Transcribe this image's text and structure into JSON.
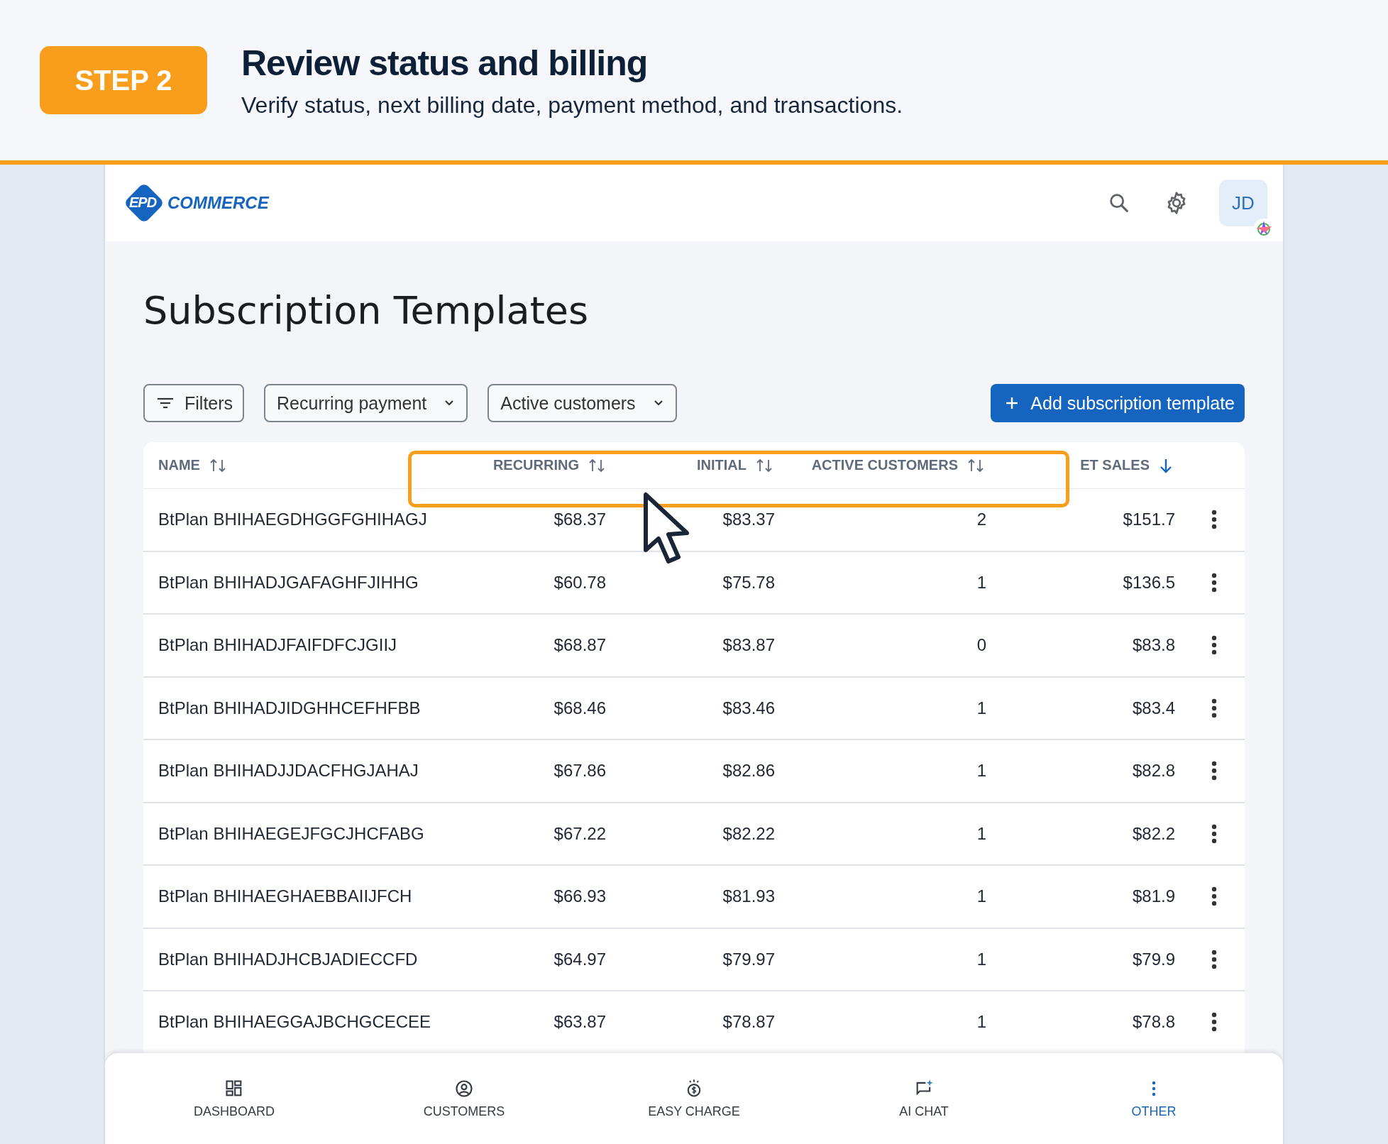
{
  "banner": {
    "step": "STEP 2",
    "title": "Review status and billing",
    "subtitle": "Verify status, next billing date, payment method, and transactions."
  },
  "header": {
    "logo_mark": "EPD",
    "logo_text": "COMMERCE",
    "avatar": "JD"
  },
  "page_title": "Subscription Templates",
  "toolbar": {
    "filters": "Filters",
    "dropdowns": [
      "Recurring payment",
      "Active customers"
    ],
    "add_button": "Add subscription template"
  },
  "table": {
    "columns": [
      {
        "label": "NAME",
        "kind": "sortable"
      },
      {
        "label": "RECURRING",
        "kind": "sortable"
      },
      {
        "label": "INITIAL",
        "kind": "sortable"
      },
      {
        "label": "ACTIVE CUSTOMERS",
        "kind": "sortable"
      },
      {
        "label": "ET SALES",
        "kind": "sorted"
      }
    ],
    "rows": [
      {
        "name": "BtPlan BHIHAEGDHGGFGHIHAGJ",
        "recurring": "$68.37",
        "initial": "$83.37",
        "active_customers": "2",
        "net_sales": "$151.7"
      },
      {
        "name": "BtPlan BHIHADJGAFAGHFJIHHG",
        "recurring": "$60.78",
        "initial": "$75.78",
        "active_customers": "1",
        "net_sales": "$136.5"
      },
      {
        "name": "BtPlan BHIHADJFAIFDFCJGIIJ",
        "recurring": "$68.87",
        "initial": "$83.87",
        "active_customers": "0",
        "net_sales": "$83.8"
      },
      {
        "name": "BtPlan BHIHADJIDGHHCEFHFBB",
        "recurring": "$68.46",
        "initial": "$83.46",
        "active_customers": "1",
        "net_sales": "$83.4"
      },
      {
        "name": "BtPlan BHIHADJJDACFHGJAHAJ",
        "recurring": "$67.86",
        "initial": "$82.86",
        "active_customers": "1",
        "net_sales": "$82.8"
      },
      {
        "name": "BtPlan BHIHAEGEJFGCJHCFABG",
        "recurring": "$67.22",
        "initial": "$82.22",
        "active_customers": "1",
        "net_sales": "$82.2"
      },
      {
        "name": "BtPlan BHIHAEGHAEBBAIIJFCH",
        "recurring": "$66.93",
        "initial": "$81.93",
        "active_customers": "1",
        "net_sales": "$81.9"
      },
      {
        "name": "BtPlan BHIHADJHCBJADIECCFD",
        "recurring": "$64.97",
        "initial": "$79.97",
        "active_customers": "1",
        "net_sales": "$79.9"
      },
      {
        "name": "BtPlan BHIHAEGGAJBCHGCECEE",
        "recurring": "$63.87",
        "initial": "$78.87",
        "active_customers": "1",
        "net_sales": "$78.8"
      }
    ]
  },
  "bottom_nav": [
    {
      "label": "DASHBOARD",
      "kind": "dashboard",
      "selected": false
    },
    {
      "label": "CUSTOMERS",
      "kind": "customers",
      "selected": false
    },
    {
      "label": "EASY CHARGE",
      "kind": "charge",
      "selected": false
    },
    {
      "label": "AI CHAT",
      "kind": "chat",
      "selected": false
    },
    {
      "label": "OTHER",
      "kind": "more",
      "selected": true
    }
  ]
}
